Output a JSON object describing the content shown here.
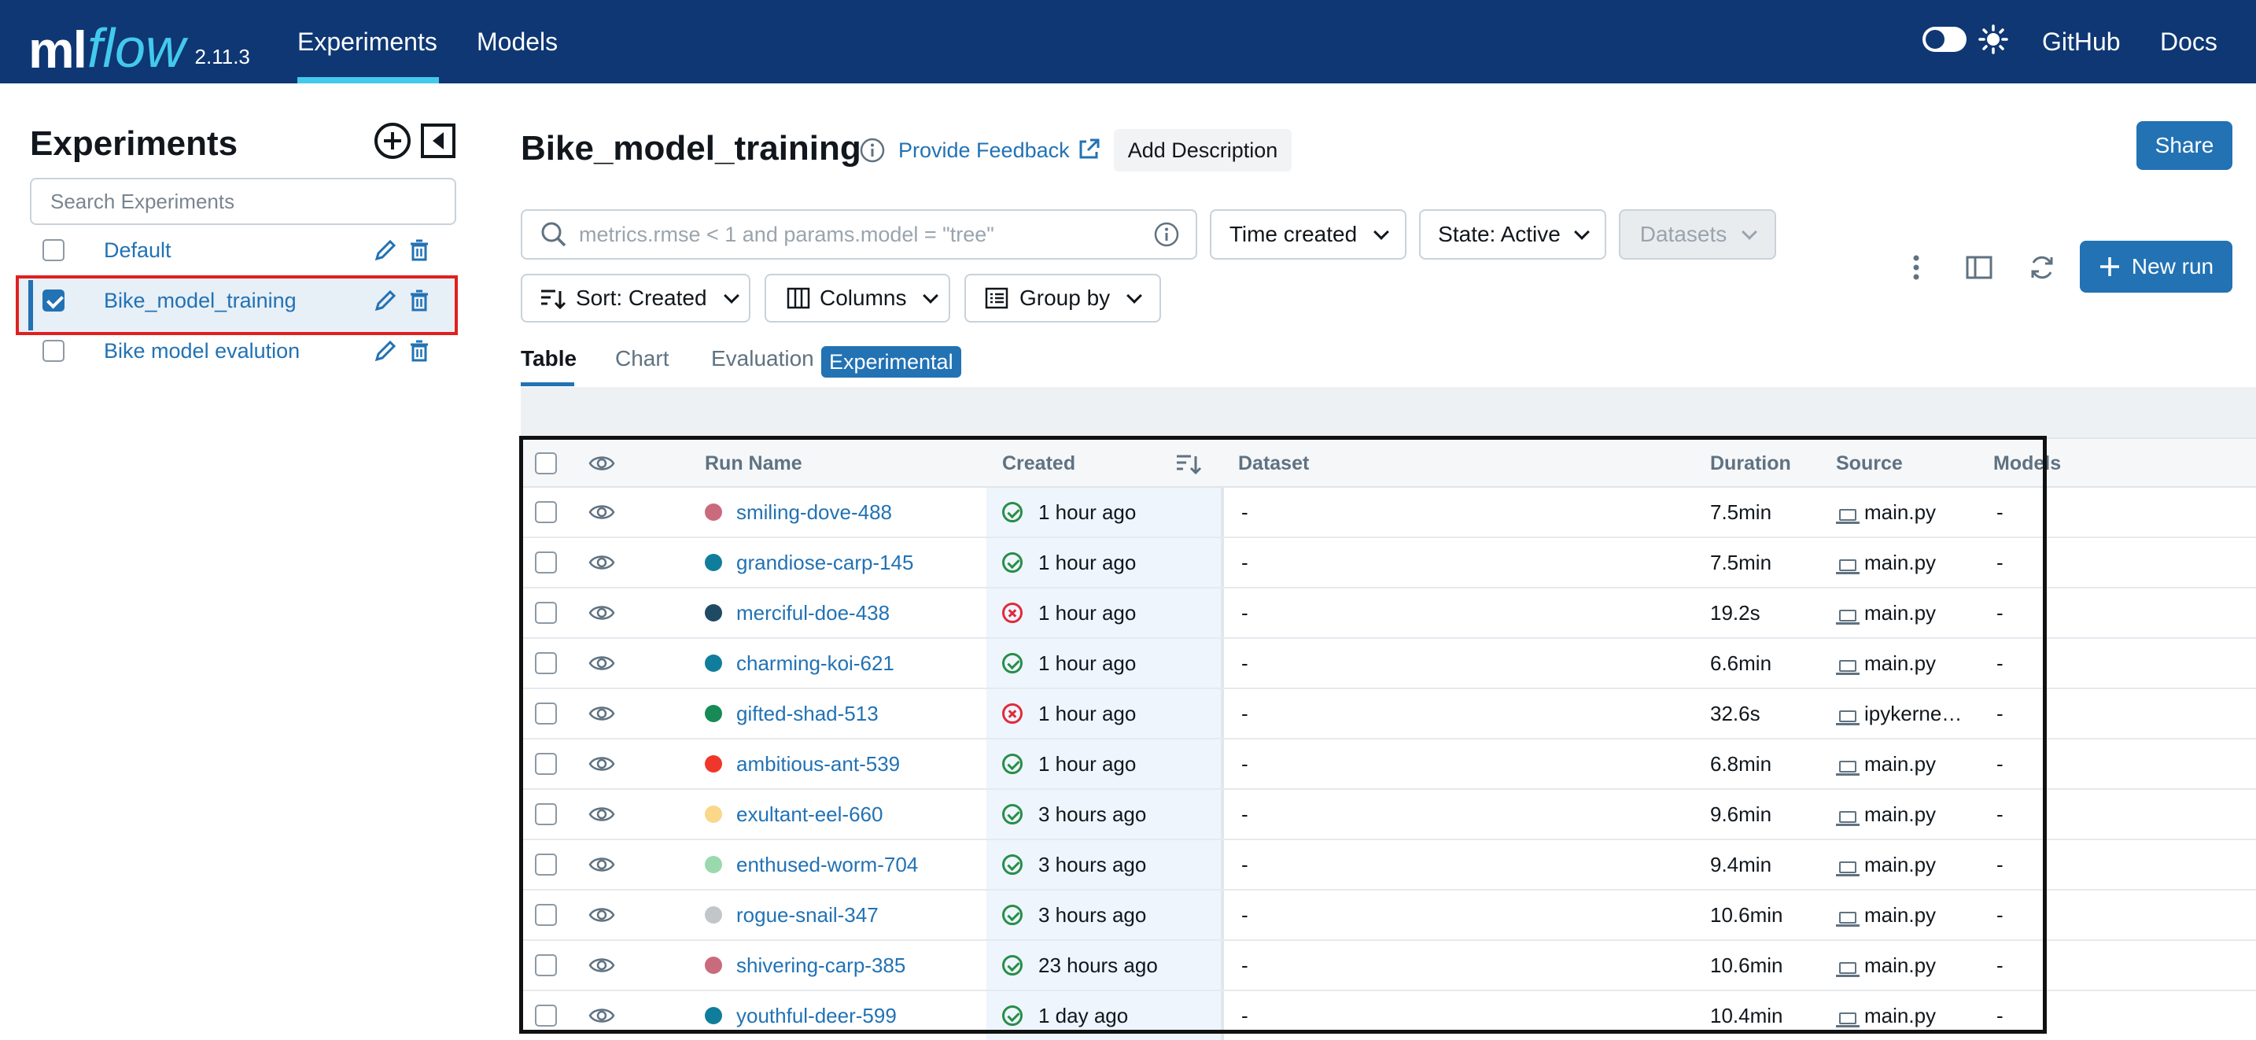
{
  "header": {
    "logo_ml": "ml",
    "logo_flow": "flow",
    "version": "2.11.3",
    "nav": [
      "Experiments",
      "Models"
    ],
    "right_links": [
      "GitHub",
      "Docs"
    ]
  },
  "sidebar": {
    "title": "Experiments",
    "search_placeholder": "Search Experiments",
    "experiments": [
      {
        "name": "Default",
        "checked": false
      },
      {
        "name": "Bike_model_training",
        "checked": true
      },
      {
        "name": "Bike model evalution",
        "checked": false
      }
    ]
  },
  "main": {
    "title": "Bike_model_training",
    "feedback": "Provide Feedback",
    "add_description": "Add Description",
    "share": "Share",
    "search_placeholder": "metrics.rmse < 1 and params.model = \"tree\"",
    "time_created": "Time created",
    "state": "State: Active",
    "datasets": "Datasets",
    "sort": "Sort: Created",
    "columns": "Columns",
    "group_by": "Group by",
    "new_run": "New run",
    "tabs": [
      "Table",
      "Chart",
      "Evaluation"
    ],
    "experimental_badge": "Experimental"
  },
  "table": {
    "headers": {
      "run_name": "Run Name",
      "created": "Created",
      "dataset": "Dataset",
      "duration": "Duration",
      "source": "Source",
      "models": "Models"
    },
    "rows": [
      {
        "name": "smiling-dove-488",
        "color": "#c96b7c",
        "status": "ok",
        "created": "1 hour ago",
        "dataset": "-",
        "duration": "7.5min",
        "source": "main.py",
        "models": "-"
      },
      {
        "name": "grandiose-carp-145",
        "color": "#107d9c",
        "status": "ok",
        "created": "1 hour ago",
        "dataset": "-",
        "duration": "7.5min",
        "source": "main.py",
        "models": "-"
      },
      {
        "name": "merciful-doe-438",
        "color": "#1f4a63",
        "status": "fail",
        "created": "1 hour ago",
        "dataset": "-",
        "duration": "19.2s",
        "source": "main.py",
        "models": "-"
      },
      {
        "name": "charming-koi-621",
        "color": "#107d9c",
        "status": "ok",
        "created": "1 hour ago",
        "dataset": "-",
        "duration": "6.6min",
        "source": "main.py",
        "models": "-"
      },
      {
        "name": "gifted-shad-513",
        "color": "#178a55",
        "status": "fail",
        "created": "1 hour ago",
        "dataset": "-",
        "duration": "32.6s",
        "source": "ipykerne…",
        "models": "-"
      },
      {
        "name": "ambitious-ant-539",
        "color": "#f0362b",
        "status": "ok",
        "created": "1 hour ago",
        "dataset": "-",
        "duration": "6.8min",
        "source": "main.py",
        "models": "-"
      },
      {
        "name": "exultant-eel-660",
        "color": "#fbd78a",
        "status": "ok",
        "created": "3 hours ago",
        "dataset": "-",
        "duration": "9.6min",
        "source": "main.py",
        "models": "-"
      },
      {
        "name": "enthused-worm-704",
        "color": "#9ad9ab",
        "status": "ok",
        "created": "3 hours ago",
        "dataset": "-",
        "duration": "9.4min",
        "source": "main.py",
        "models": "-"
      },
      {
        "name": "rogue-snail-347",
        "color": "#c3c6c9",
        "status": "ok",
        "created": "3 hours ago",
        "dataset": "-",
        "duration": "10.6min",
        "source": "main.py",
        "models": "-"
      },
      {
        "name": "shivering-carp-385",
        "color": "#c96b7c",
        "status": "ok",
        "created": "23 hours ago",
        "dataset": "-",
        "duration": "10.6min",
        "source": "main.py",
        "models": "-"
      },
      {
        "name": "youthful-deer-599",
        "color": "#107d9c",
        "status": "ok",
        "created": "1 day ago",
        "dataset": "-",
        "duration": "10.4min",
        "source": "main.py",
        "models": "-"
      }
    ]
  }
}
